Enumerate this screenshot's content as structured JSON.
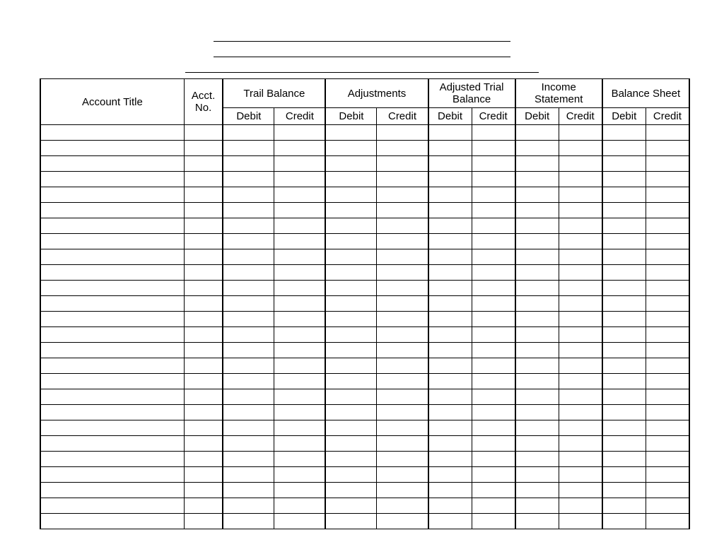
{
  "title_blank_lines": 3,
  "headers": {
    "account_title": "Account Title",
    "acct_no_line1": "Acct.",
    "acct_no_line2": "No.",
    "groups": [
      {
        "label": "Trail Balance",
        "sub": [
          "Debit",
          "Credit"
        ]
      },
      {
        "label": "Adjustments",
        "sub": [
          "Debit",
          "Credit"
        ]
      },
      {
        "label": "Adjusted Trial Balance",
        "sub": [
          "Debit",
          "Credit"
        ]
      },
      {
        "label": "Income Statement",
        "sub": [
          "Debit",
          "Credit"
        ]
      },
      {
        "label": "Balance Sheet",
        "sub": [
          "Debit",
          "Credit"
        ]
      }
    ]
  },
  "data_rows": 26
}
